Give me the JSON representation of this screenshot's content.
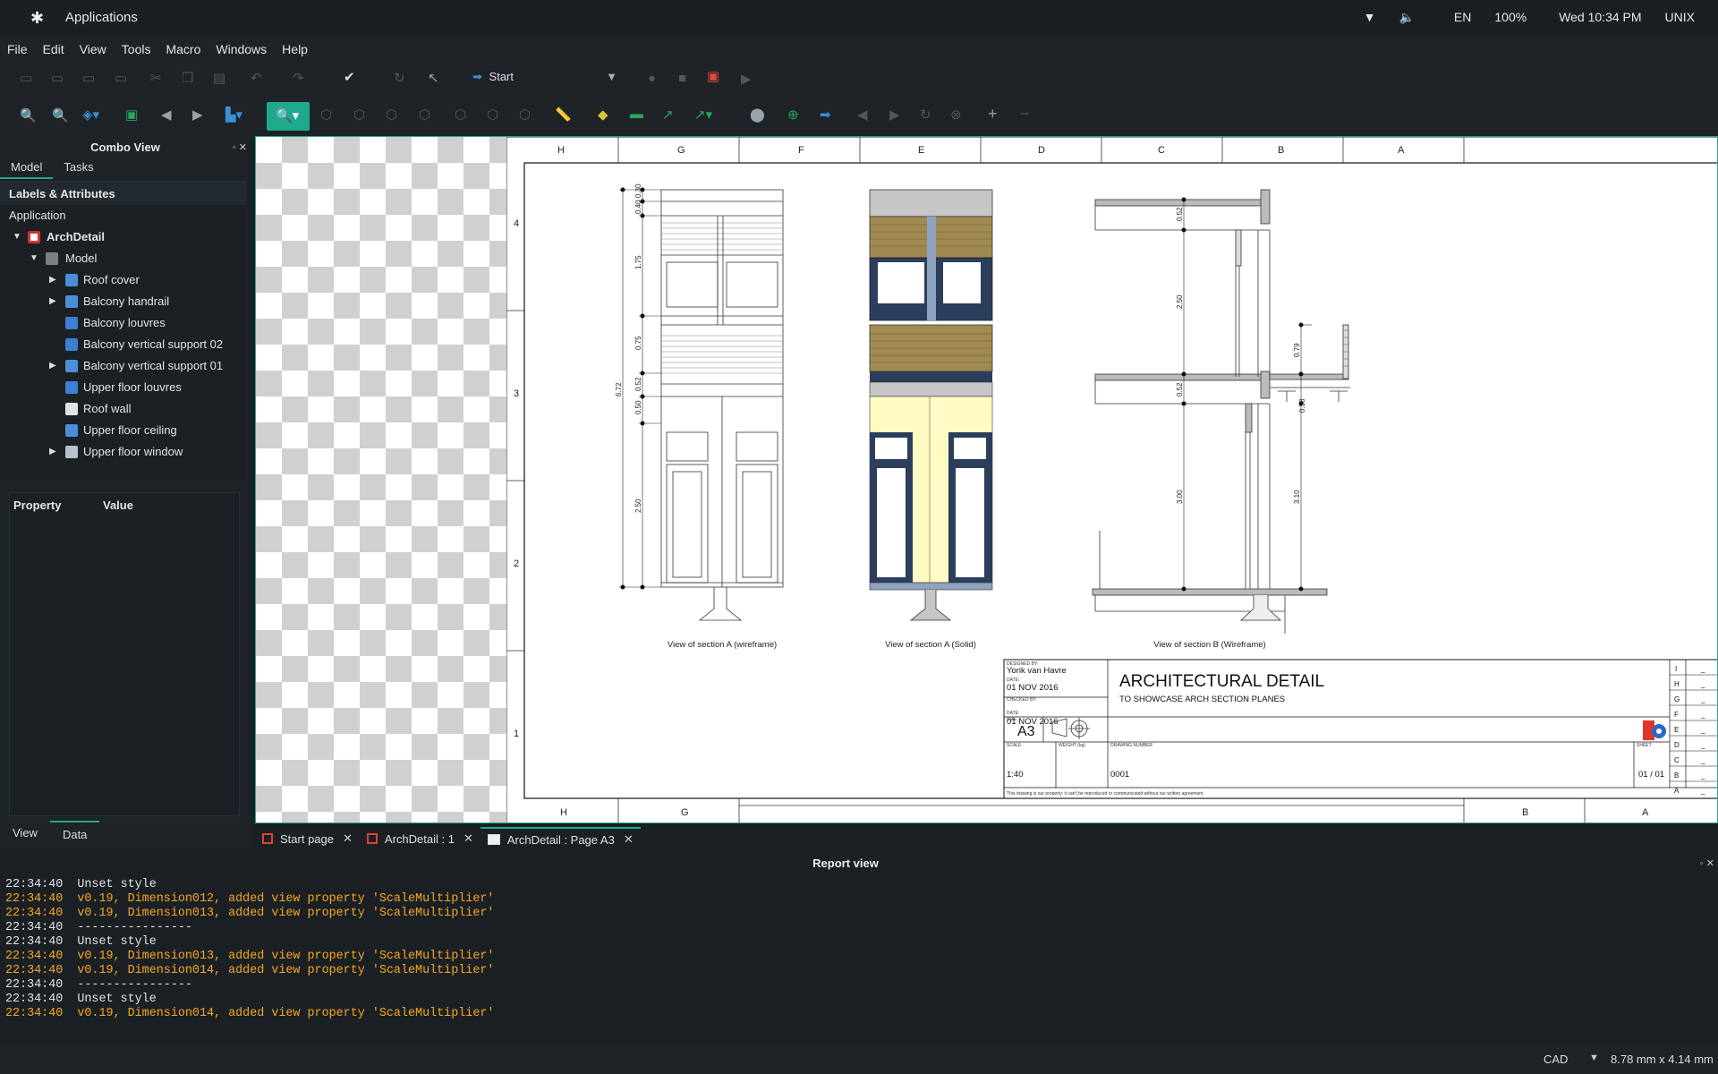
{
  "system": {
    "apps_label": "Applications",
    "lang": "EN",
    "battery": "100%",
    "clock": "Wed 10:34 PM",
    "session": "UNIX"
  },
  "menu": [
    "File",
    "Edit",
    "View",
    "Tools",
    "Macro",
    "Windows",
    "Help"
  ],
  "toolbar": {
    "workbench": "Start"
  },
  "combo": {
    "title": "Combo View",
    "tab_model": "Model",
    "tab_tasks": "Tasks",
    "tree_header": "Labels & Attributes",
    "tree_root_label": "Application",
    "document": "ArchDetail",
    "group": "Model",
    "items": [
      {
        "label": "Roof cover",
        "expand": true,
        "icon": "multi"
      },
      {
        "label": "Balcony handrail",
        "expand": true,
        "icon": "multi"
      },
      {
        "label": "Balcony louvres",
        "expand": false,
        "icon": "part"
      },
      {
        "label": "Balcony vertical support 02",
        "expand": false,
        "icon": "part"
      },
      {
        "label": "Balcony vertical support 01",
        "expand": true,
        "icon": "multi"
      },
      {
        "label": "Upper floor louvres",
        "expand": false,
        "icon": "part"
      },
      {
        "label": "Roof wall",
        "expand": false,
        "icon": "wall"
      },
      {
        "label": "Upper floor ceiling",
        "expand": false,
        "icon": "slab"
      },
      {
        "label": "Upper floor window",
        "expand": true,
        "icon": "window"
      }
    ],
    "prop_col": "Property",
    "value_col": "Value",
    "tab_view": "View",
    "tab_data": "Data"
  },
  "drawing": {
    "col_letters": [
      "H",
      "G",
      "F",
      "E",
      "D",
      "C",
      "B",
      "A"
    ],
    "row_numbers": [
      "4",
      "3",
      "2",
      "1"
    ],
    "bottom_letters": [
      "H",
      "G",
      "B",
      "A"
    ],
    "view1_caption": "View of section A (wireframe)",
    "view2_caption": "View of section A (Solid)",
    "view3_caption": "View of section B (Wireframe)",
    "dims_a": [
      "0.30",
      "0.40",
      "1.75",
      "0.75",
      "0.52",
      "0.50",
      "2.50",
      "6.72"
    ],
    "dims_b": [
      "0.52",
      "2.50",
      "0.79",
      "0.52",
      "0.38",
      "3.00",
      "3.10"
    ],
    "titleblock": {
      "designed_by_label": "DESIGNED BY:",
      "designer": "Yorik van Havre",
      "date_label": "DATE:",
      "date1": "01 NOV 2016",
      "checked_label": "CHECKED BY:",
      "date2": "01 NOV 2016",
      "size_label": "SIZE",
      "size": "A3",
      "title": "ARCHITECTURAL DETAIL",
      "subtitle": "TO SHOWCASE ARCH SECTION PLANES",
      "scale_label": "SCALE",
      "scale": "1:40",
      "weight_label": "WEIGHT (kg)",
      "drawing_no_label": "DRAWING NUMBER",
      "drawing_no": "0001",
      "sheet_label": "SHEET",
      "sheet": "01 / 01",
      "disclaimer": "This drawing is our property; it can't be reproduced or communicated without our written agreement.",
      "revisions": [
        "I",
        "H",
        "G",
        "F",
        "E",
        "D",
        "C",
        "B",
        "A"
      ],
      "rev_value": "_"
    }
  },
  "doc_tabs": [
    {
      "label": "Start page",
      "icon": "freecad"
    },
    {
      "label": "ArchDetail : 1",
      "icon": "freecad"
    },
    {
      "label": "ArchDetail : Page A3",
      "icon": "page"
    }
  ],
  "report": {
    "title": "Report view",
    "lines": [
      {
        "t": "22:34:40  Unset style",
        "warn": false
      },
      {
        "t": "22:34:40  v0.19, Dimension012, added view property 'ScaleMultiplier'",
        "warn": true
      },
      {
        "t": "22:34:40  v0.19, Dimension013, added view property 'ScaleMultiplier'",
        "warn": true
      },
      {
        "t": "22:34:40  ----------------",
        "warn": false
      },
      {
        "t": "22:34:40  Unset style",
        "warn": false
      },
      {
        "t": "22:34:40  v0.19, Dimension013, added view property 'ScaleMultiplier'",
        "warn": true
      },
      {
        "t": "22:34:40  v0.19, Dimension014, added view property 'ScaleMultiplier'",
        "warn": true
      },
      {
        "t": "22:34:40  ----------------",
        "warn": false
      },
      {
        "t": "22:34:40  Unset style",
        "warn": false
      },
      {
        "t": "22:34:40  v0.19, Dimension014, added view property 'ScaleMultiplier'",
        "warn": true
      }
    ]
  },
  "status": {
    "nav": "CAD",
    "dimensions": "8.78 mm x 4.14 mm"
  },
  "colors": {
    "accent": "#1fa98d",
    "warning": "#f5a623",
    "louvre": "#a18a52",
    "frame": "#2c3e5c",
    "wall_fill": "#fffbc2"
  }
}
